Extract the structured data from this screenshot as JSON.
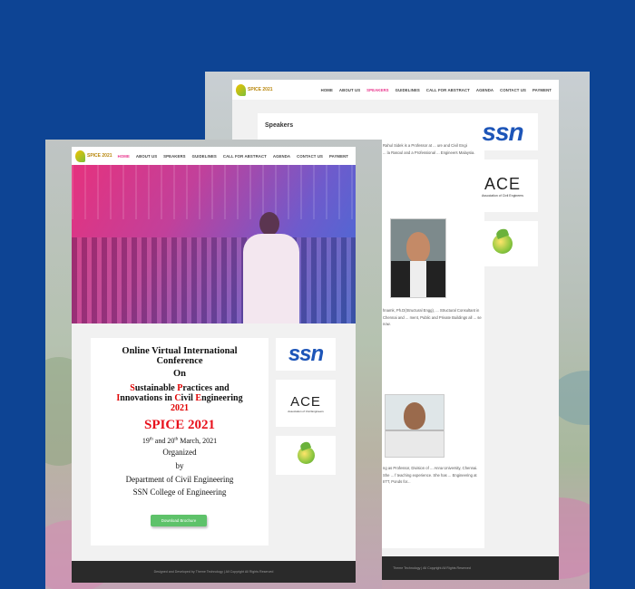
{
  "back_page": {
    "logo_text": "SPICE 2021",
    "nav": [
      "HOME",
      "ABOUT US",
      "SPEAKERS",
      "GUIDELINES",
      "CALL FOR ABSTRACT",
      "AGENDA",
      "CONTACT US",
      "PAYMENT"
    ],
    "active_nav": "SPEAKERS",
    "speakers_title": "Speakers",
    "speaker1_text": "Rahul Sidek is a Professor at ... ure and Civil Engineering ... la Rasoul and a Professional ... Engineers Malaysia.",
    "speaker2_text": "hnamk, Ph.D(Structural Engg), ... Structural Consultant in Chennai and ... ment, Public and Private Buildings all ... se now.",
    "speaker3_text": "ng as Professor, Division of ... Anna University, Chennai. She ... f teaching experience. She has ... Engineering at IITT, Ponds for...",
    "side_logos": [
      "ssn",
      "ACE",
      "Association of Civil Engineers",
      "globe"
    ],
    "footer": "Theme Technology | All Copyright All Rights Reserved"
  },
  "front_page": {
    "logo_text": "SPICE 2021",
    "nav": [
      "HOME",
      "ABOUT US",
      "SPEAKERS",
      "GUIDELINES",
      "CALL FOR ABSTRACT",
      "AGENDA",
      "CONTACT US",
      "PAYMENT"
    ],
    "active_nav": "HOME",
    "card": {
      "title_line1": "Online Virtual International",
      "title_line2": "Conference",
      "on": "On",
      "theme_line1_parts": [
        "S",
        "ustainable ",
        "P",
        "ractices and"
      ],
      "theme_line2_parts": [
        "I",
        "nnovations in ",
        "C",
        "ivil ",
        "E",
        "ngineering"
      ],
      "theme_year": "2021",
      "spice": "SPICE 2021",
      "date_day1": "19",
      "date_sup1": "th",
      "date_and": " and 20",
      "date_sup2": "th",
      "date_rest": "  March, 2021",
      "organized": "Organized",
      "by": "by",
      "department": "Department of Civil Engineering",
      "college": "SSN College of Engineering",
      "download_label": "Download Brochure"
    },
    "side_logos": {
      "ssn": "ssn",
      "ace": "ACE",
      "ace_sub": "Association of Civil Engineers"
    },
    "footer": "Designed and Developed by Theme Technology | All Copyright All Rights Reserved"
  },
  "colors": {
    "background": "#0d4494",
    "active_nav": "#e8318a",
    "accent_red": "#e00000",
    "button_green": "#5ec26a",
    "ssn_blue": "#1d55b8"
  }
}
